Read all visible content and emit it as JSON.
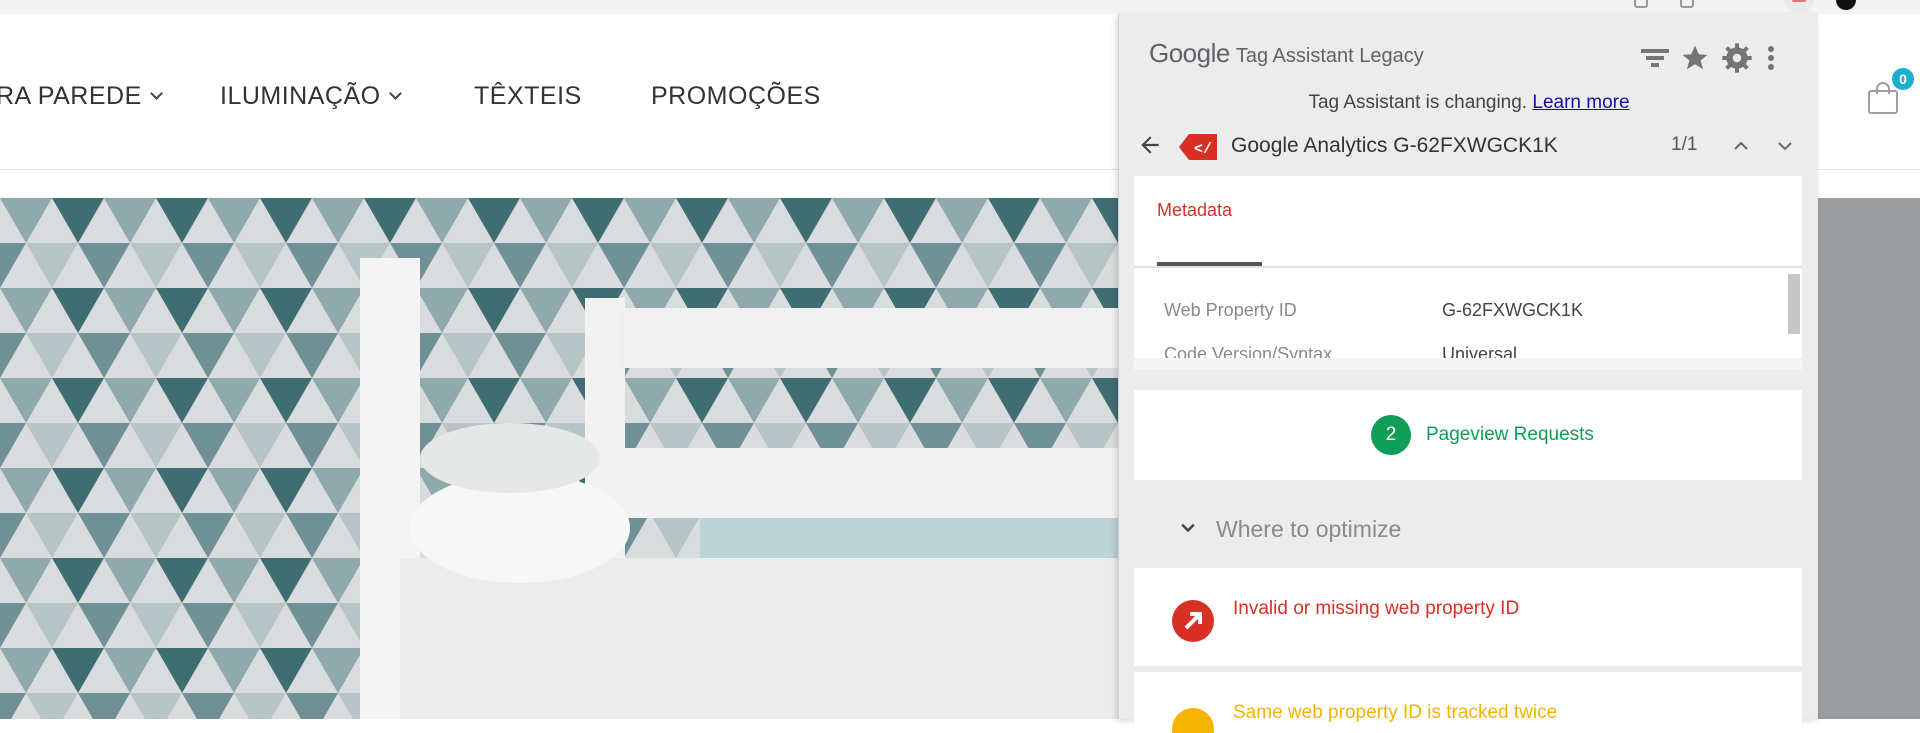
{
  "site": {
    "nav": [
      {
        "label": "RA PAREDE",
        "has_dropdown": true
      },
      {
        "label": "ILUMINAÇÃO",
        "has_dropdown": true
      },
      {
        "label": "TÊXTEIS",
        "has_dropdown": false
      },
      {
        "label": "PROMOÇÕES",
        "has_dropdown": false
      }
    ],
    "cart_count": "0",
    "colors": {
      "cart_badge": "#1bb0d0"
    }
  },
  "popup": {
    "brand": "Google",
    "title": "Tag Assistant Legacy",
    "toolbar_icons": [
      "filter-icon",
      "star-icon",
      "gear-icon",
      "more-vert-icon"
    ],
    "notice_text": "Tag Assistant is changing.",
    "notice_link": "Learn more",
    "tag": {
      "name": "Google Analytics G-62FXWGCK1K",
      "icon_label": "</",
      "counter": "1/1"
    },
    "tabs": [
      {
        "label": "Metadata",
        "active": true
      }
    ],
    "metadata": [
      {
        "key": "Web Property ID",
        "value": "G-62FXWGCK1K"
      },
      {
        "key": "Code Version/Syntax",
        "value": "Universal"
      }
    ],
    "pageview": {
      "count": "2",
      "label": "Pageview Requests"
    },
    "optimize_label": "Where to optimize",
    "issues": [
      {
        "text": "Invalid or missing web property ID",
        "severity": "error"
      },
      {
        "text": "Same web property ID is tracked twice",
        "severity": "warning"
      }
    ],
    "colors": {
      "error": "#d93025",
      "warning": "#f4b400",
      "success": "#0f9d58",
      "link": "#1a0dab"
    }
  }
}
